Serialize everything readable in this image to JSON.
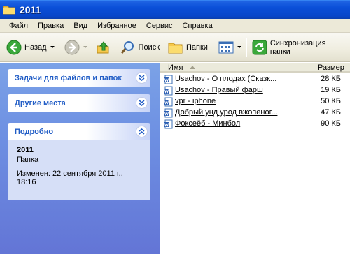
{
  "window": {
    "title": "2011"
  },
  "menu": [
    "Файл",
    "Правка",
    "Вид",
    "Избранное",
    "Сервис",
    "Справка"
  ],
  "toolbar": {
    "back_label": "Назад",
    "search_label": "Поиск",
    "folders_label": "Папки",
    "sync_label": "Синхронизация папки"
  },
  "taskpane": {
    "tasks_title": "Задачи для файлов и папок",
    "places_title": "Другие места",
    "details_title": "Подробно",
    "details": {
      "name": "2011",
      "type": "Папка",
      "modified": "Изменен: 22 сентября 2011 г., 18:16"
    }
  },
  "filelist": {
    "col_name": "Имя",
    "col_size": "Размер",
    "files": [
      {
        "name": "Usachov - О плодах (Сказк...",
        "size": "28 КБ"
      },
      {
        "name": "Usachov - Правый фарш",
        "size": "19 КБ"
      },
      {
        "name": "vpr - iphone",
        "size": "50 КБ"
      },
      {
        "name": "Добрый унд урод вжопеног...",
        "size": "47 КБ"
      },
      {
        "name": "Фоксеёб - Минбол",
        "size": "90 КБ"
      }
    ]
  },
  "colors": {
    "titlebar": "#0a4fd8",
    "taskpane": "#6d8fe2",
    "panel_title": "#215dc6",
    "panel_body": "#d6dff7"
  }
}
